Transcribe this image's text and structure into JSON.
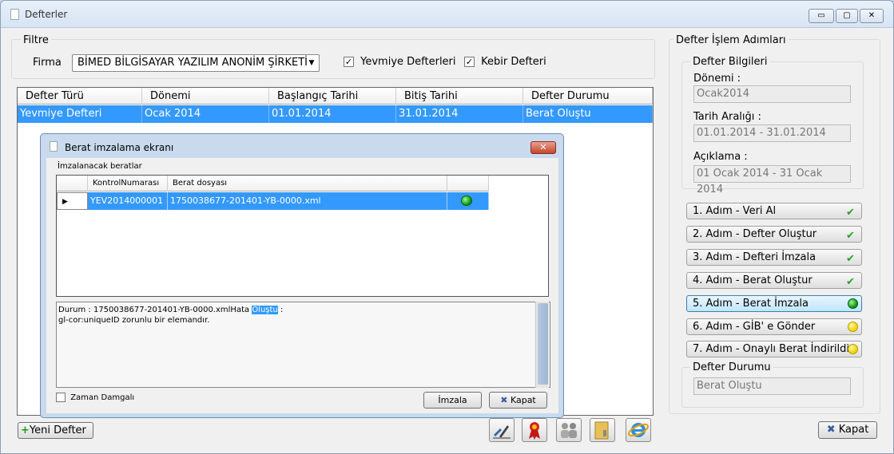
{
  "window": {
    "title": "Defterler",
    "controls": {
      "minimize": "▭",
      "maximize": "▢",
      "close": "✕"
    }
  },
  "filter": {
    "group_label": "Filtre",
    "firma_label": "Firma",
    "firma_value": "BİMED BİLGİSAYAR YAZILIM ANONİM ŞİRKETİ",
    "combo_arrow": "▼",
    "checks": [
      {
        "label": "Yevmiye Defterleri",
        "checked": true,
        "mark": "✓"
      },
      {
        "label": "Kebir Defteri",
        "checked": true,
        "mark": "✓"
      }
    ]
  },
  "table": {
    "columns": [
      "Defter Türü",
      "Dönemi",
      "Başlangıç Tarihi",
      "Bitiş Tarihi",
      "Defter Durumu"
    ],
    "rows": [
      [
        "Yevmiye Defteri",
        "Ocak 2014",
        "01.01.2014",
        "31.01.2014",
        "Berat Oluştu"
      ]
    ]
  },
  "bottom": {
    "new_button": "Yeni Defter",
    "new_icon": "+",
    "toolbar_icons": [
      "sign-tools-icon",
      "award-ribbon-icon",
      "users-icon",
      "folder-icon",
      "internet-explorer-icon"
    ],
    "close_button": "Kapat",
    "close_icon": "✖"
  },
  "right_panel": {
    "group_label": "Defter İşlem Adımları",
    "info_label": "Defter Bilgileri",
    "donemi_label": "Dönemi :",
    "donemi_value": "Ocak2014",
    "tarih_label": "Tarih Aralığı :",
    "tarih_value": "01.01.2014 - 31.01.2014",
    "aciklama_label": "Açıklama :",
    "aciklama_value": "01 Ocak 2014 - 31 Ocak 2014",
    "steps": [
      {
        "label": "1. Adım - Veri Al",
        "status": "done",
        "mark": "✔"
      },
      {
        "label": "2. Adım - Defter Oluştur",
        "status": "done",
        "mark": "✔"
      },
      {
        "label": "3. Adım - Defteri İmzala",
        "status": "done",
        "mark": "✔"
      },
      {
        "label": "4. Adım - Berat Oluştur",
        "status": "done",
        "mark": "✔"
      },
      {
        "label": "5. Adım - Berat İmzala",
        "status": "active"
      },
      {
        "label": "6. Adım - GİB' e Gönder",
        "status": "pending"
      },
      {
        "label": "7. Adım - Onaylı Berat İndirildi",
        "status": "pending"
      }
    ],
    "durum_label": "Defter Durumu",
    "durum_value": "Berat Oluştu"
  },
  "dialog": {
    "title": "Berat imzalama ekranı",
    "close": "✕",
    "section_label": "İmzalanacak beratlar",
    "columns": [
      "KontrolNumarası",
      "Berat dosyası"
    ],
    "row_marker": "▶",
    "rows": [
      {
        "kontrol": "YEV2014000001",
        "dosya": "1750038677-201401-YB-0000.xml"
      }
    ],
    "status_line1_pre": "Durum : 1750038677-201401-YB-0000.xmlHata ",
    "status_line1_hl": "Oluştu",
    "status_line1_post": " :",
    "status_line2": "gl-cor:uniqueID zorunlu bir elemandır.",
    "timestamp_label": "Zaman Damgalı",
    "sign_button": "İmzala",
    "close_button": "Kapat",
    "close_icon": "✖"
  }
}
